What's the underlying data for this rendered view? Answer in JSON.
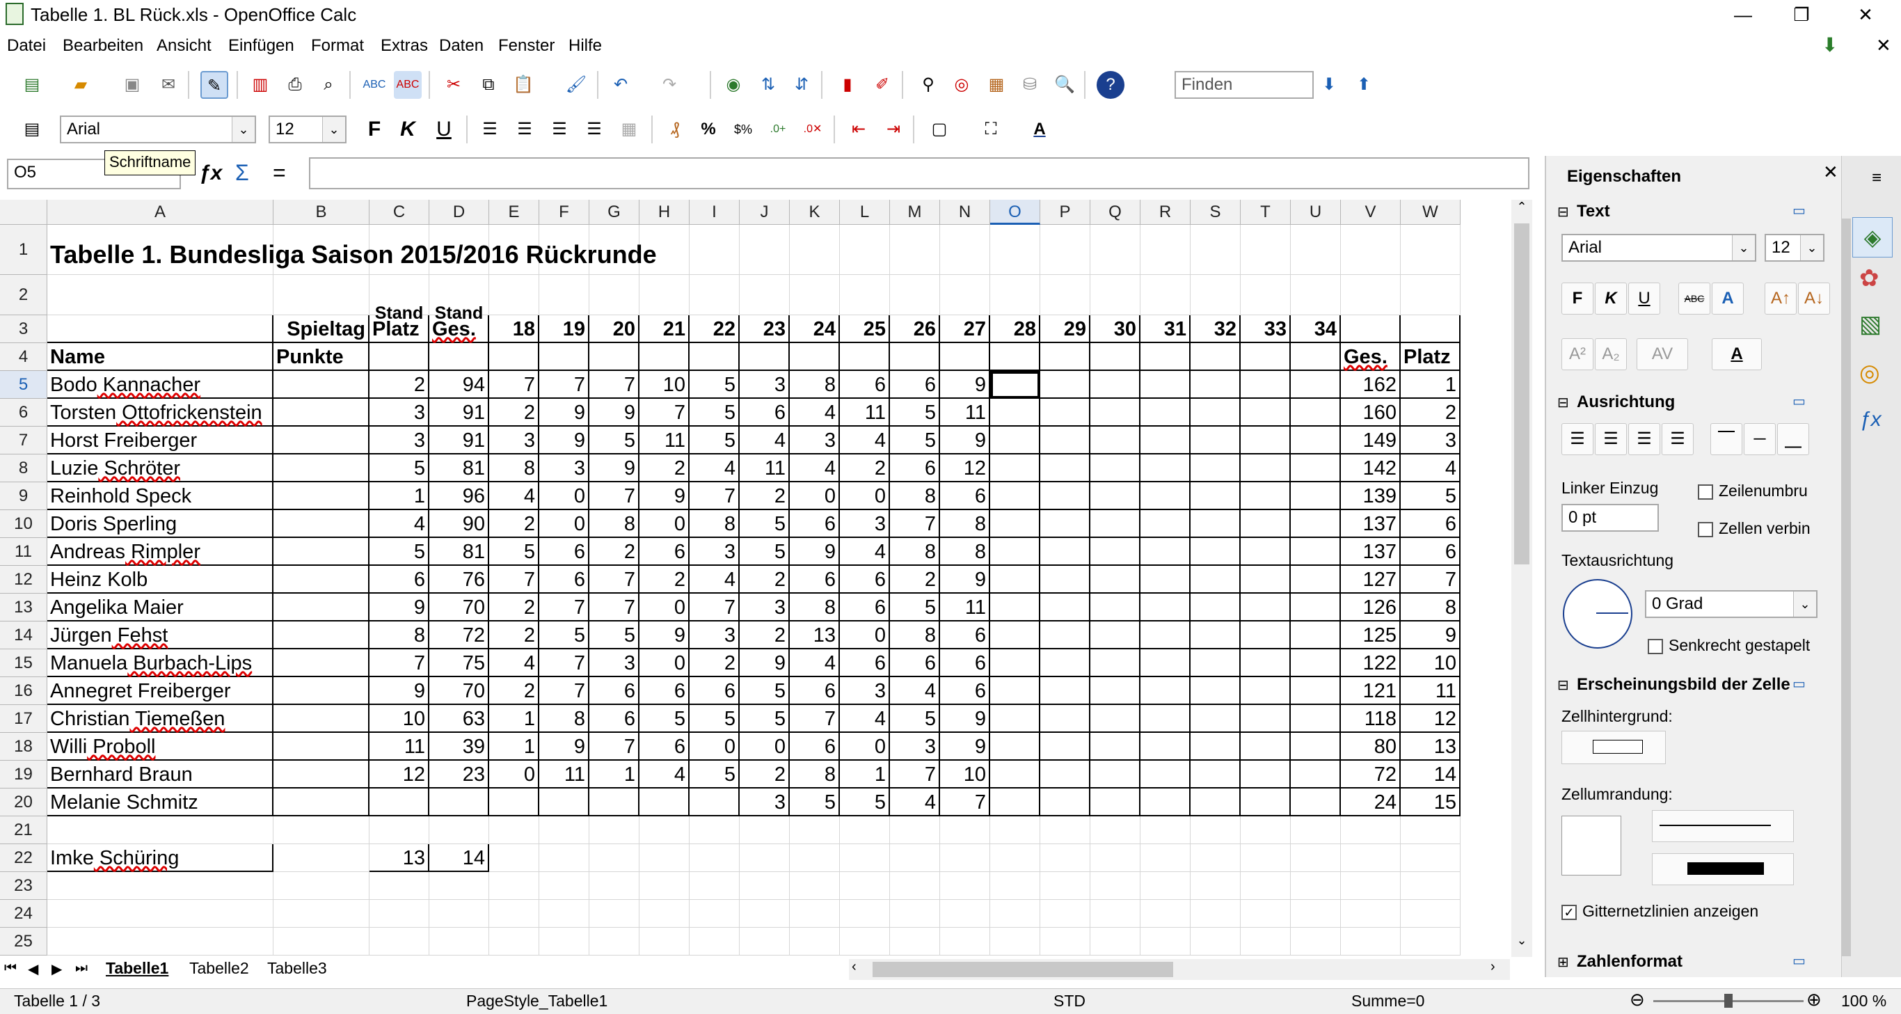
{
  "window": {
    "title": "Tabelle 1. BL Rück.xls - OpenOffice Calc"
  },
  "menu": [
    "Datei",
    "Bearbeiten",
    "Ansicht",
    "Einfügen",
    "Format",
    "Extras",
    "Daten",
    "Fenster",
    "Hilfe"
  ],
  "toolbar": {
    "find_placeholder": "Finden"
  },
  "format_toolbar": {
    "font_name": "Arial",
    "font_size": "12",
    "tooltip": "Schriftname",
    "bold": "F",
    "italic": "K",
    "underline": "U"
  },
  "formula_bar": {
    "cell_ref": "O5",
    "content": "",
    "equals": "="
  },
  "columns": [
    "A",
    "B",
    "C",
    "D",
    "E",
    "F",
    "G",
    "H",
    "I",
    "J",
    "K",
    "L",
    "M",
    "N",
    "O",
    "P",
    "Q",
    "R",
    "S",
    "T",
    "U",
    "V",
    "W"
  ],
  "sheet": {
    "title": "Tabelle 1. Bundesliga Saison 2015/2016 Rückrunde",
    "header_stand": "Stand",
    "header_spieltag": "Spieltag",
    "header_platz": "Platz",
    "header_ges": "Ges.",
    "header_name": "Name",
    "header_punkte": "Punkte",
    "header_ges_total": "Ges.",
    "header_platz_total": "Platz",
    "spieltage": [
      "18",
      "19",
      "20",
      "21",
      "22",
      "23",
      "24",
      "25",
      "26",
      "27",
      "28",
      "29",
      "30",
      "31",
      "32",
      "33",
      "34"
    ],
    "rows": [
      {
        "n": "5",
        "name": "Bodo Kannacher",
        "c": "2",
        "d": "94",
        "v": [
          "7",
          "7",
          "7",
          "10",
          "5",
          "3",
          "8",
          "6",
          "6",
          "9"
        ],
        "ges": "162",
        "platz": "1"
      },
      {
        "n": "6",
        "name": "Torsten Ottofrickenstein",
        "c": "3",
        "d": "91",
        "v": [
          "2",
          "9",
          "9",
          "7",
          "5",
          "6",
          "4",
          "11",
          "5",
          "11"
        ],
        "ges": "160",
        "platz": "2"
      },
      {
        "n": "7",
        "name": "Horst Freiberger",
        "c": "3",
        "d": "91",
        "v": [
          "3",
          "9",
          "5",
          "11",
          "5",
          "4",
          "3",
          "4",
          "5",
          "9"
        ],
        "ges": "149",
        "platz": "3"
      },
      {
        "n": "8",
        "name": "Luzie Schröter",
        "c": "5",
        "d": "81",
        "v": [
          "8",
          "3",
          "9",
          "2",
          "4",
          "11",
          "4",
          "2",
          "6",
          "12"
        ],
        "ges": "142",
        "platz": "4"
      },
      {
        "n": "9",
        "name": "Reinhold Speck",
        "c": "1",
        "d": "96",
        "v": [
          "4",
          "0",
          "7",
          "9",
          "7",
          "2",
          "0",
          "0",
          "8",
          "6"
        ],
        "ges": "139",
        "platz": "5"
      },
      {
        "n": "10",
        "name": "Doris Sperling",
        "c": "4",
        "d": "90",
        "v": [
          "2",
          "0",
          "8",
          "0",
          "8",
          "5",
          "6",
          "3",
          "7",
          "8"
        ],
        "ges": "137",
        "platz": "6"
      },
      {
        "n": "11",
        "name": "Andreas Rimpler",
        "c": "5",
        "d": "81",
        "v": [
          "5",
          "6",
          "2",
          "6",
          "3",
          "5",
          "9",
          "4",
          "8",
          "8"
        ],
        "ges": "137",
        "platz": "6"
      },
      {
        "n": "12",
        "name": "Heinz Kolb",
        "c": "6",
        "d": "76",
        "v": [
          "7",
          "6",
          "7",
          "2",
          "4",
          "2",
          "6",
          "6",
          "2",
          "9"
        ],
        "ges": "127",
        "platz": "7"
      },
      {
        "n": "13",
        "name": "Angelika Maier",
        "c": "9",
        "d": "70",
        "v": [
          "2",
          "7",
          "7",
          "0",
          "7",
          "3",
          "8",
          "6",
          "5",
          "11"
        ],
        "ges": "126",
        "platz": "8"
      },
      {
        "n": "14",
        "name": "Jürgen Fehst",
        "c": "8",
        "d": "72",
        "v": [
          "2",
          "5",
          "5",
          "9",
          "3",
          "2",
          "13",
          "0",
          "8",
          "6"
        ],
        "ges": "125",
        "platz": "9"
      },
      {
        "n": "15",
        "name": "Manuela Burbach-Lips",
        "c": "7",
        "d": "75",
        "v": [
          "4",
          "7",
          "3",
          "0",
          "2",
          "9",
          "4",
          "6",
          "6",
          "6"
        ],
        "ges": "122",
        "platz": "10"
      },
      {
        "n": "16",
        "name": "Annegret Freiberger",
        "c": "9",
        "d": "70",
        "v": [
          "2",
          "7",
          "6",
          "6",
          "6",
          "5",
          "6",
          "3",
          "4",
          "6"
        ],
        "ges": "121",
        "platz": "11"
      },
      {
        "n": "17",
        "name": "Christian Tiemeßen",
        "c": "10",
        "d": "63",
        "v": [
          "1",
          "8",
          "6",
          "5",
          "5",
          "5",
          "7",
          "4",
          "5",
          "9"
        ],
        "ges": "118",
        "platz": "12"
      },
      {
        "n": "18",
        "name": "Willi Proboll",
        "c": "11",
        "d": "39",
        "v": [
          "1",
          "9",
          "7",
          "6",
          "0",
          "0",
          "6",
          "0",
          "3",
          "9"
        ],
        "ges": "80",
        "platz": "13"
      },
      {
        "n": "19",
        "name": "Bernhard Braun",
        "c": "12",
        "d": "23",
        "v": [
          "0",
          "11",
          "1",
          "4",
          "5",
          "2",
          "8",
          "1",
          "7",
          "10"
        ],
        "ges": "72",
        "platz": "14"
      },
      {
        "n": "20",
        "name": "Melanie Schmitz",
        "c": "",
        "d": "",
        "v": [
          "",
          "",
          "",
          "",
          "",
          "3",
          "5",
          "5",
          "4",
          "7"
        ],
        "ges": "24",
        "platz": "15"
      }
    ],
    "extra_row": {
      "n": "22",
      "name": "Imke Schüring",
      "c": "13",
      "d": "14"
    },
    "row_numbers": [
      "1",
      "2",
      "3",
      "4",
      "5",
      "6",
      "7",
      "8",
      "9",
      "10",
      "11",
      "12",
      "13",
      "14",
      "15",
      "16",
      "17",
      "18",
      "19",
      "20",
      "21",
      "22",
      "23",
      "24",
      "25"
    ]
  },
  "sheet_tabs": [
    "Tabelle1",
    "Tabelle2",
    "Tabelle3"
  ],
  "sidebar": {
    "title": "Eigenschaften",
    "text_section": "Text",
    "font_name": "Arial",
    "font_size": "12",
    "bold": "F",
    "italic": "K",
    "underline": "U",
    "strike": "ABC",
    "align_section": "Ausrichtung",
    "indent_label": "Linker Einzug",
    "indent_value": "0 pt",
    "wrap_label": "Zeilenumbru",
    "merge_label": "Zellen verbin",
    "orientation_label": "Textausrichtung",
    "orientation_value": "0 Grad",
    "vertical_label": "Senkrecht gestapelt",
    "appearance_section": "Erscheinungsbild der Zelle",
    "background_label": "Zellhintergrund:",
    "border_label": "Zellumrandung:",
    "gridlines_label": "Gitternetzlinien anzeigen",
    "number_section": "Zahlenformat"
  },
  "status": {
    "sheet": "Tabelle 1 / 3",
    "page_style": "PageStyle_Tabelle1",
    "mode": "STD",
    "sum": "Summe=0",
    "zoom": "100 %",
    "zoom_fraction": 0.5
  }
}
